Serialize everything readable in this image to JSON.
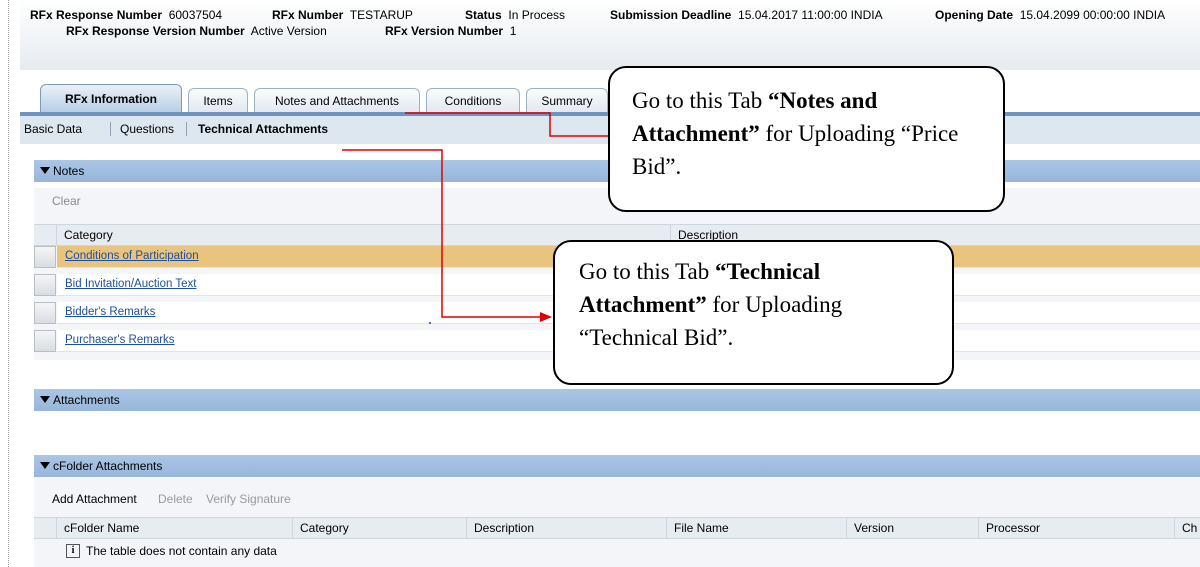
{
  "header": {
    "response_number_label": "RFx Response Number",
    "response_number_value": "60037504",
    "rfx_number_label": "RFx Number",
    "rfx_number_value": "TESTARUP",
    "status_label": "Status",
    "status_value": "In Process",
    "deadline_label": "Submission Deadline",
    "deadline_value": "15.04.2017 11:00:00 INDIA",
    "opening_label": "Opening Date",
    "opening_value": "15.04.2099 00:00:00 INDIA",
    "response_version_label": "RFx Response Version Number",
    "response_version_value": "Active Version",
    "rfx_version_label": "RFx Version Number",
    "rfx_version_value": "1"
  },
  "tabs": [
    {
      "label": "RFx Information"
    },
    {
      "label": "Items"
    },
    {
      "label": "Notes and Attachments"
    },
    {
      "label": "Conditions"
    },
    {
      "label": "Summary"
    }
  ],
  "subnav": [
    "Basic Data",
    "Questions",
    "Technical Attachments"
  ],
  "notes": {
    "title": "Notes",
    "clear_label": "Clear",
    "col_category": "Category",
    "col_description": "Description",
    "rows": [
      "Conditions of Participation",
      "Bid Invitation/Auction Text",
      "Bidder's Remarks",
      "Purchaser's Remarks"
    ]
  },
  "attachments": {
    "title": "Attachments"
  },
  "cfolder": {
    "title": "cFolder Attachments",
    "toolbar": {
      "add": "Add Attachment",
      "delete": "Delete",
      "verify": "Verify Signature"
    },
    "columns": [
      "cFolder Name",
      "Category",
      "Description",
      "File Name",
      "Version",
      "Processor",
      "Ch"
    ],
    "empty_text": "The table does not contain any data"
  },
  "callouts": {
    "notes_pre": "Go to this Tab ",
    "notes_bold": "“Notes and Attachment”",
    "notes_post": " for Uploading “Price Bid”.",
    "tech_pre": "Go to this Tab ",
    "tech_bold": "“Technical Attachment”",
    "tech_post": " for Uploading “Technical Bid”."
  },
  "colors": {
    "selected_row": "#e8c47e",
    "section_bar": "#9dbbdd",
    "arrow": "#e00000",
    "link": "#1d4fa0"
  },
  "icons": {
    "info": "info-icon",
    "collapse": "triangle-down-icon"
  }
}
